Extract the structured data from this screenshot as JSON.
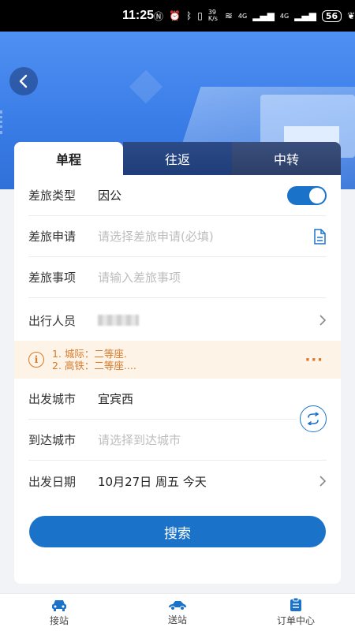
{
  "status_bar": {
    "time": "11:25",
    "net_speed": "39 K/s",
    "signal1": "4G",
    "signal2": "4G",
    "battery": "56"
  },
  "tabs": [
    {
      "label": "单程",
      "active": true
    },
    {
      "label": "往返",
      "active": false
    },
    {
      "label": "中转",
      "active": false
    }
  ],
  "form": {
    "travel_type": {
      "label": "差旅类型",
      "value": "因公",
      "toggle_on": true
    },
    "travel_application": {
      "label": "差旅申请",
      "placeholder": "请选择差旅申请(必填)"
    },
    "travel_matter": {
      "label": "差旅事项",
      "placeholder": "请输入差旅事项"
    },
    "traveler": {
      "label": "出行人员"
    },
    "notice": {
      "line1": "1. 城际：二等座.",
      "line2": "2. 高铁：二等座....",
      "more": "···"
    },
    "depart_city": {
      "label": "出发城市",
      "value": "宜宾西"
    },
    "arrive_city": {
      "label": "到达城市",
      "placeholder": "请选择到达城市"
    },
    "depart_date": {
      "label": "出发日期",
      "value": "10月27日 周五 今天"
    }
  },
  "search_label": "搜索",
  "bottom_nav": [
    {
      "label": "接站",
      "icon": "car-icon"
    },
    {
      "label": "送站",
      "icon": "sedan-icon"
    },
    {
      "label": "订单中心",
      "icon": "clipboard-icon"
    }
  ],
  "colors": {
    "primary": "#1b73c9",
    "notice_text": "#d97a2b",
    "notice_bg": "#fdf3e6"
  }
}
